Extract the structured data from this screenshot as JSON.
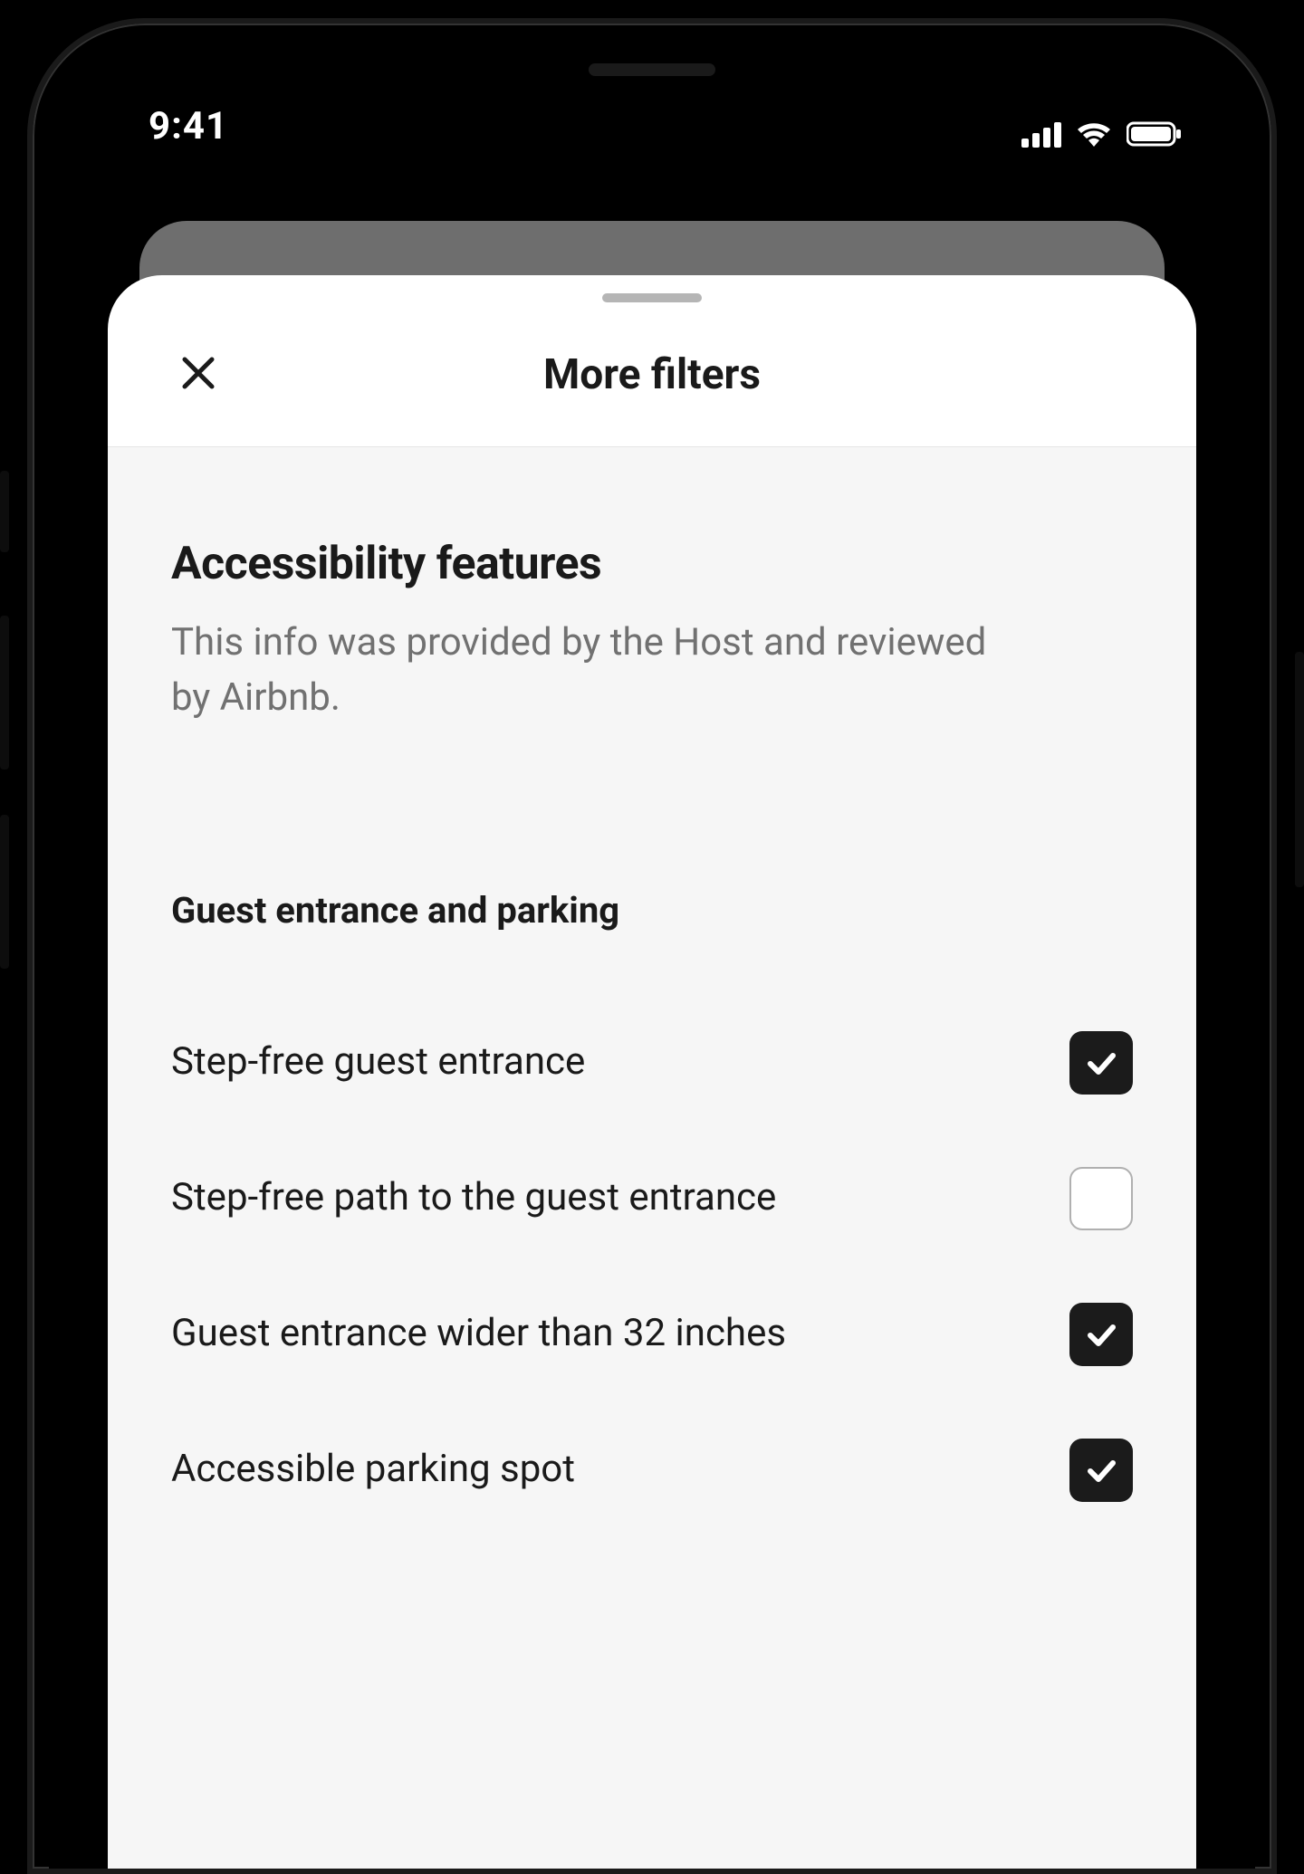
{
  "statusbar": {
    "time": "9:41"
  },
  "sheet": {
    "title": "More filters",
    "section": {
      "heading": "Accessibility features",
      "description": "This info was provided by the Host and reviewed by Airbnb."
    },
    "group": {
      "title": "Guest entrance and parking",
      "options": [
        {
          "label": "Step-free guest entrance",
          "checked": true
        },
        {
          "label": "Step-free path to the guest entrance",
          "checked": false
        },
        {
          "label": "Guest entrance wider than 32 inches",
          "checked": true
        },
        {
          "label": "Accessible parking spot",
          "checked": true
        }
      ]
    }
  }
}
